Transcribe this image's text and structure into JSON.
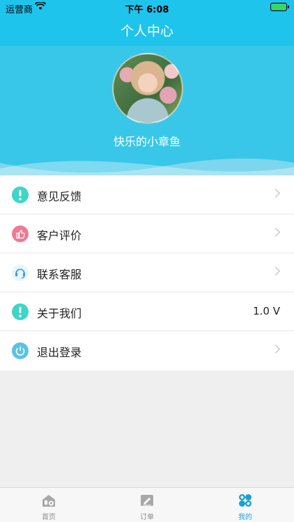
{
  "status_bar": {
    "carrier": "运营商",
    "time": "下午 6:08"
  },
  "nav": {
    "title": "个人中心"
  },
  "profile": {
    "username": "快乐的小章鱼"
  },
  "menu": [
    {
      "label": "意见反馈",
      "icon": "exclamation-icon",
      "color": "#3ed6c7",
      "value": ""
    },
    {
      "label": "客户评价",
      "icon": "thumbs-up-icon",
      "color": "#f07a93",
      "value": ""
    },
    {
      "label": "联系客服",
      "icon": "headset-icon",
      "color": "#2a9de4",
      "value": ""
    },
    {
      "label": "关于我们",
      "icon": "exclamation-icon",
      "color": "#3ed6c7",
      "value": "1.0 V"
    },
    {
      "label": "退出登录",
      "icon": "power-icon",
      "color": "#5ac2e6",
      "value": ""
    }
  ],
  "tabbar": {
    "tabs": [
      {
        "label": "首页",
        "icon": "home-icon",
        "active": false
      },
      {
        "label": "订单",
        "icon": "order-icon",
        "active": false
      },
      {
        "label": "我的",
        "icon": "clover-icon",
        "active": true
      }
    ],
    "active_color": "#1ea4dc",
    "inactive_color": "#8e8e8e"
  },
  "theme": {
    "header_color": "#1ec4ec",
    "profile_color": "#38c7e8"
  }
}
